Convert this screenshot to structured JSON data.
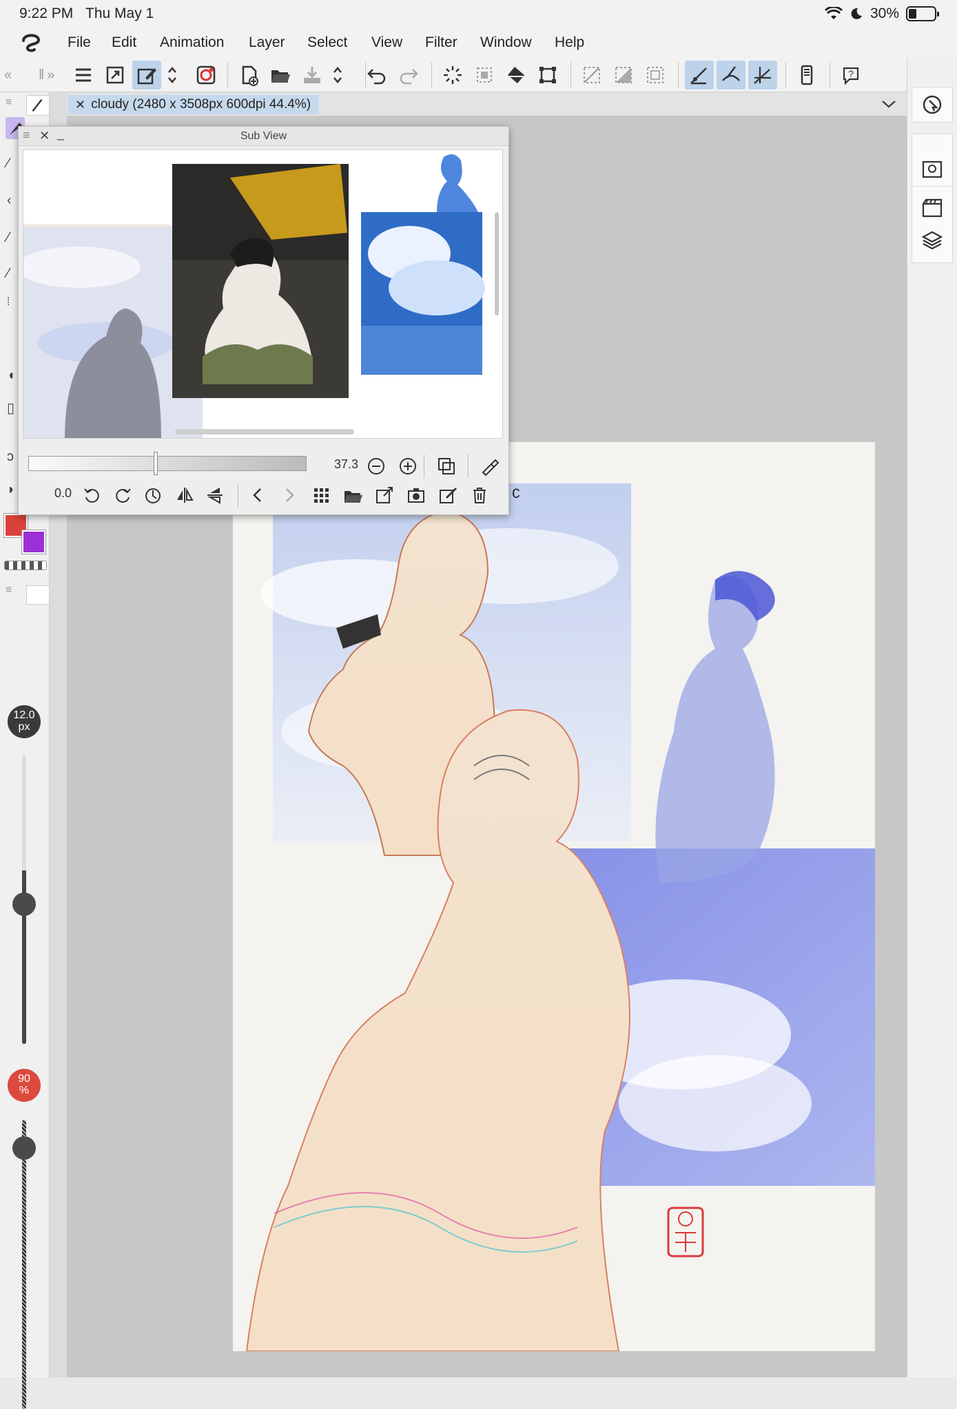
{
  "status": {
    "time": "9:22 PM",
    "date": "Thu May 1",
    "battery": "30%",
    "battery_level": 0.3
  },
  "menu": {
    "items": [
      "File",
      "Edit",
      "Animation",
      "Layer",
      "Select",
      "View",
      "Filter",
      "Window",
      "Help"
    ]
  },
  "document": {
    "tab_title": "cloudy (2480 x 3508px 600dpi 44.4%)",
    "stamp_text": "REC"
  },
  "subview": {
    "title": "Sub View",
    "zoom": "37.3",
    "rotation": "0.0"
  },
  "brush": {
    "size_value": "12.0",
    "size_unit": "px",
    "opacity_value": "90",
    "opacity_unit": "%"
  },
  "colors": {
    "main_color": "#d9423a",
    "sub_color": "#9b30d8",
    "accent": "#bcd3ea"
  }
}
